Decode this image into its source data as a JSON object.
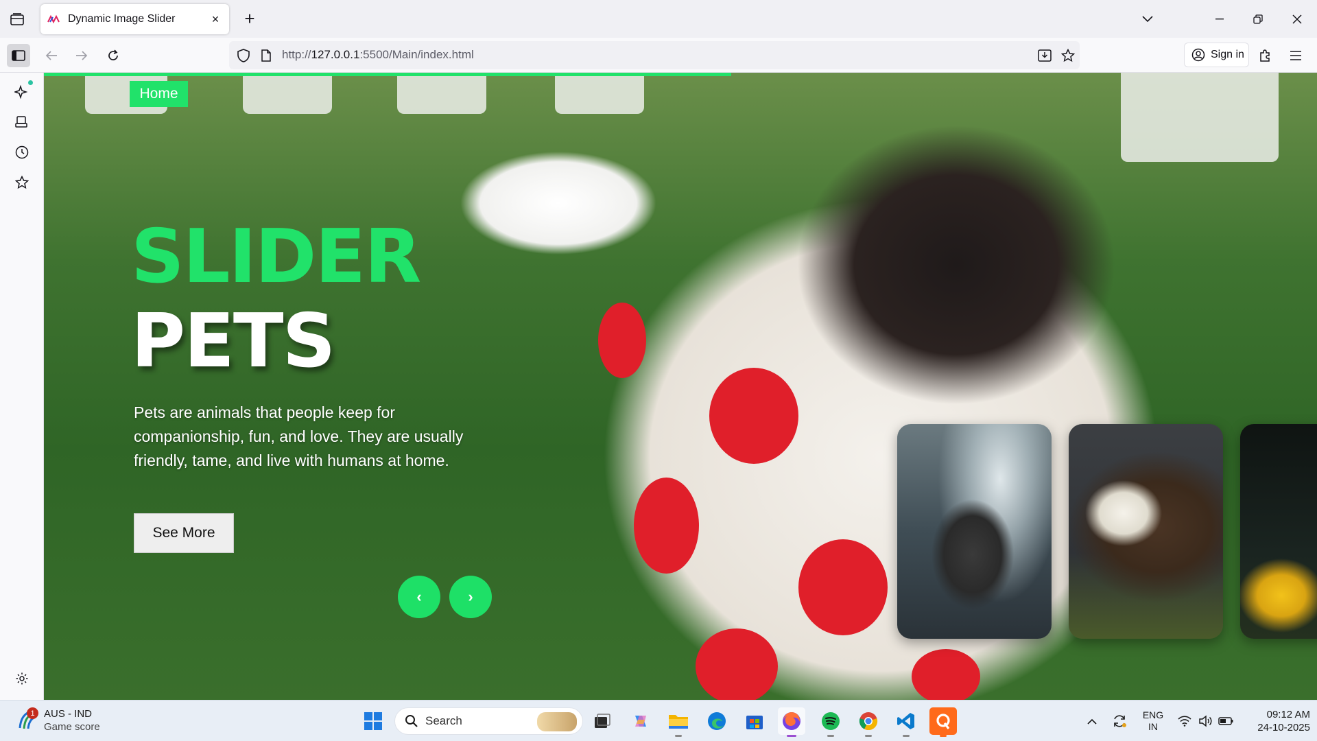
{
  "browser": {
    "tab": {
      "title": "Dynamic Image Slider",
      "close": "×"
    },
    "new_tab": "+",
    "url": {
      "scheme": "http://",
      "host": "127.0.0.1",
      "rest": ":5500/Main/index.html"
    },
    "sign_in": "Sign in"
  },
  "page": {
    "home_link": "Home",
    "title": "SLIDER",
    "subtitle": "PETS",
    "description": "Pets are animals that people keep for companionship, fun, and love. They are usually friendly, tame, and live with humans at home.",
    "see_more": "See More",
    "prev": "‹",
    "next": "›",
    "slide_progress": 0.54,
    "accent_color": "#21e26a",
    "thumbnails": [
      {
        "name": "elephant"
      },
      {
        "name": "eagle"
      },
      {
        "name": "dragonfly-flowers"
      }
    ]
  },
  "taskbar": {
    "widget": {
      "badge": "1",
      "title": "AUS - IND",
      "subtitle": "Game score"
    },
    "search_placeholder": "Search",
    "apps": [
      "start",
      "task-view",
      "copilot",
      "file-explorer",
      "edge",
      "store",
      "firefox",
      "spotify",
      "chrome",
      "vscode",
      "app-q"
    ],
    "tray": {
      "lang_top": "ENG",
      "lang_bottom": "IN",
      "time": "09:12 AM",
      "date": "24-10-2025"
    }
  }
}
